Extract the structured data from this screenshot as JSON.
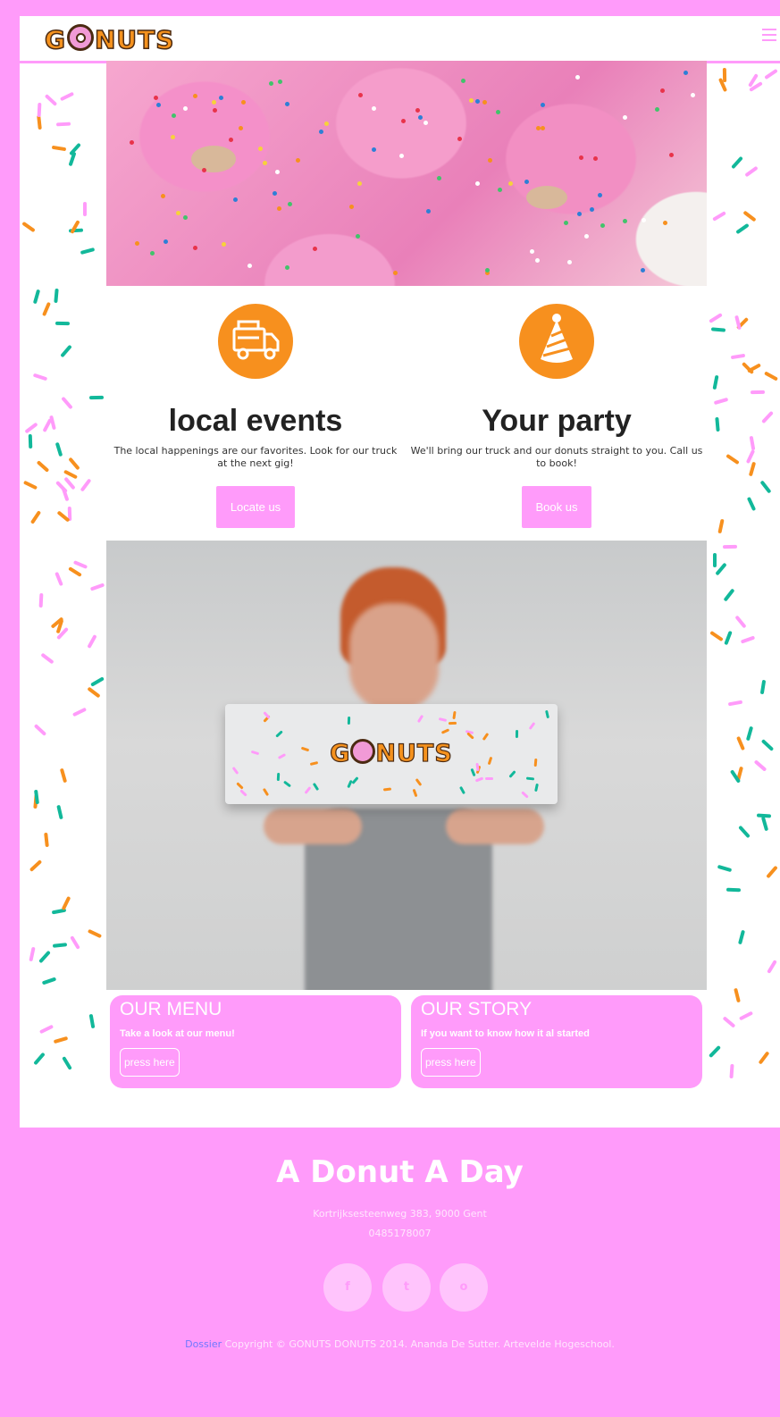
{
  "header": {
    "logo_prefix": "G",
    "logo_suffix": "NUTS",
    "menu_icon": "hamburger-menu-icon"
  },
  "features": [
    {
      "icon": "food-truck-icon",
      "title": "local events",
      "text": "The local happenings are our favorites. Look for our truck at the next gig!",
      "button": "Locate us"
    },
    {
      "icon": "party-hat-icon",
      "title": "Your party",
      "text": "We'll bring our truck and our donuts straight to you. Call us to book!",
      "button": "Book us"
    }
  ],
  "photo": {
    "box_logo_prefix": "G",
    "box_logo_suffix": "NUTS"
  },
  "cards": [
    {
      "title": "OUR MENU",
      "text": "Take a look at our menu!",
      "button": "press here"
    },
    {
      "title": "OUR STORY",
      "text": "If you want to know how it al started",
      "button": "press here"
    }
  ],
  "footer": {
    "title": "A Donut A Day",
    "address": "Kortrijksesteenweg 383, 9000 Gent",
    "phone": "0485178007",
    "social": [
      {
        "icon": "facebook-icon",
        "glyph": "f"
      },
      {
        "icon": "twitter-icon",
        "glyph": "t"
      },
      {
        "icon": "instagram-icon",
        "glyph": "o"
      }
    ],
    "dossier_link": "Dossier",
    "copyright": "Copyright © GONUTS DONUTS 2014. Ananda De Sutter. Artevelde Hogeschool."
  },
  "colors": {
    "brand_pink": "#ff9bfa",
    "accent_orange": "#f7901e"
  }
}
